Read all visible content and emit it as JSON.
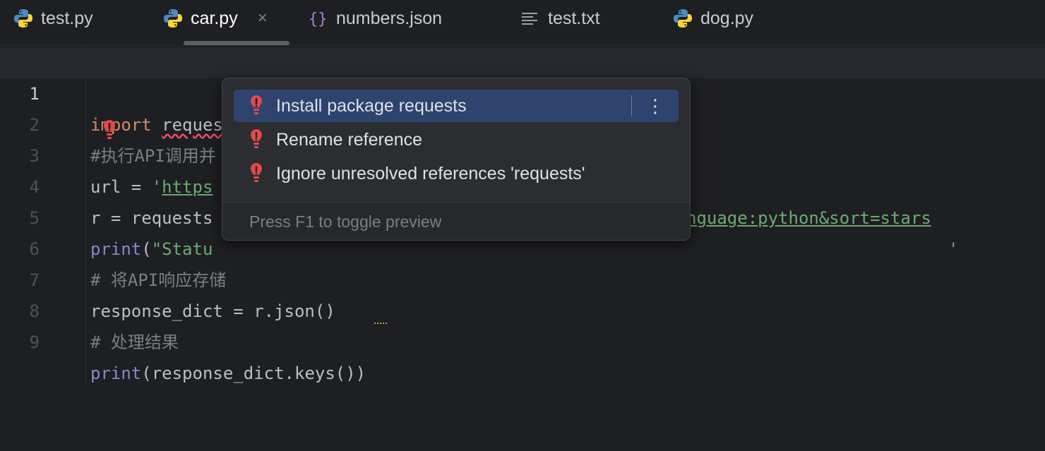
{
  "tabs": [
    {
      "label": "test.py",
      "icon": "python-icon",
      "active": false
    },
    {
      "label": "car.py",
      "icon": "python-icon",
      "active": true,
      "close": "×"
    },
    {
      "label": "numbers.json",
      "icon": "json-braces-icon",
      "active": false
    },
    {
      "label": "test.txt",
      "icon": "text-lines-icon",
      "active": false
    },
    {
      "label": "dog.py",
      "icon": "python-icon",
      "active": false
    }
  ],
  "editor": {
    "line_numbers": [
      "1",
      "2",
      "3",
      "4",
      "5",
      "6",
      "7",
      "8",
      "9"
    ],
    "lines": {
      "l1_kw": "import",
      "l1_mod": "requests",
      "l2": "#执行API调用并",
      "l3_a": "url = ",
      "l3_q": "'",
      "l3_url_a": "https",
      "l3_url_b": "nguage:python&sort=stars",
      "l3_q2": "'",
      "l4": "r = requests",
      "l5_fn": "print",
      "l5_rest_a": "(",
      "l5_str": "\"Statu",
      "l6": "# 将API响应存储",
      "l7": "response_dict = r.json()",
      "l8": "# 处理结果",
      "l9_fn": "print",
      "l9_rest": "(response_dict.keys())"
    }
  },
  "popup": {
    "items": [
      {
        "label": "Install package requests",
        "selected": true
      },
      {
        "label": "Rename reference",
        "selected": false
      },
      {
        "label": "Ignore unresolved references 'requests'",
        "selected": false
      }
    ],
    "more_icon": "⋮",
    "footer": "Press F1 to toggle preview"
  },
  "colors": {
    "background": "#1e1f22",
    "selection": "#2e436e",
    "error": "#f75464",
    "keyword": "#cf8e6d",
    "string": "#6aab73"
  }
}
